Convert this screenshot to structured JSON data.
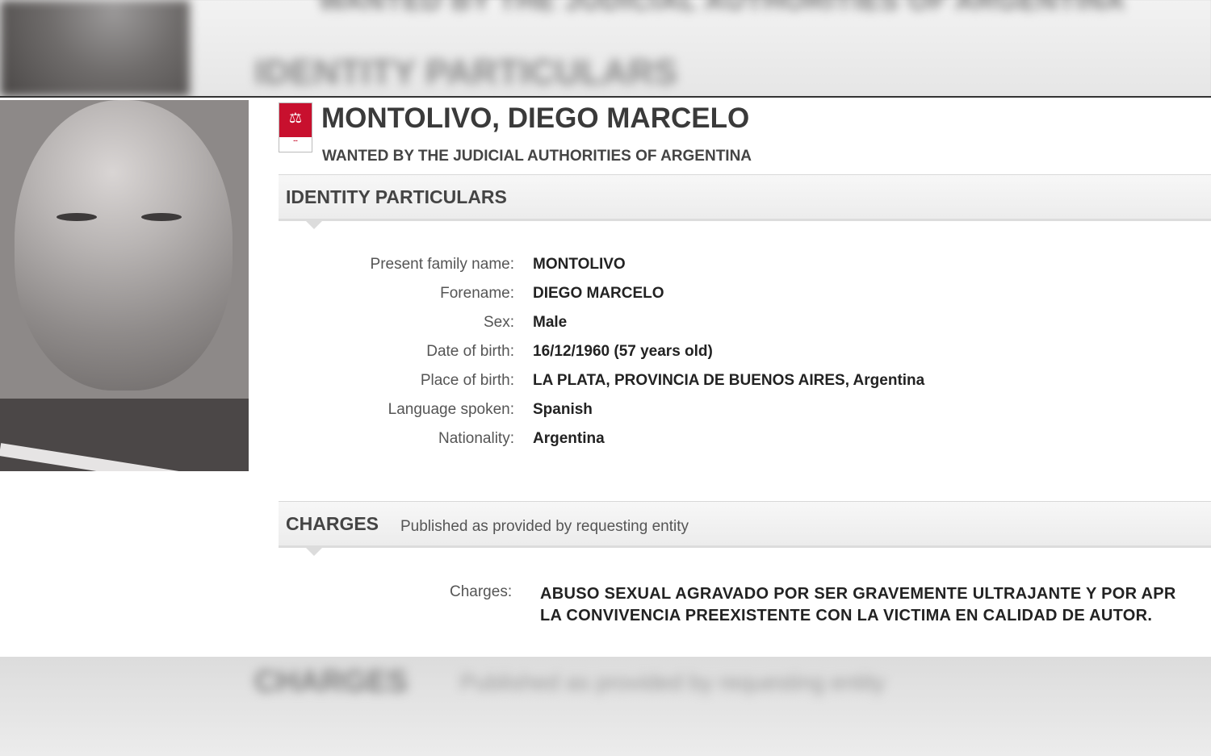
{
  "notice": {
    "name": "MONTOLIVO, DIEGO MARCELO",
    "subtitle": "WANTED BY THE JUDICIAL AUTHORITIES OF ARGENTINA"
  },
  "identity": {
    "title": "IDENTITY PARTICULARS",
    "fields": [
      {
        "label": "Present family name:",
        "value": "MONTOLIVO"
      },
      {
        "label": "Forename:",
        "value": "DIEGO MARCELO"
      },
      {
        "label": "Sex:",
        "value": "Male"
      },
      {
        "label": "Date of birth:",
        "value": "16/12/1960 (57 years old)"
      },
      {
        "label": "Place of birth:",
        "value": "LA PLATA, PROVINCIA DE BUENOS AIRES, Argentina"
      },
      {
        "label": "Language spoken:",
        "value": "Spanish"
      },
      {
        "label": "Nationality:",
        "value": "Argentina"
      }
    ]
  },
  "charges": {
    "title": "CHARGES",
    "subtitle": "Published as provided by requesting entity",
    "label": "Charges:",
    "line1": "ABUSO SEXUAL AGRAVADO POR SER GRAVEMENTE ULTRAJANTE Y POR APR",
    "line2": "LA CONVIVENCIA PREEXISTENTE CON LA VICTIMA EN CALIDAD DE AUTOR."
  },
  "colors": {
    "accent": "#c8102e"
  }
}
